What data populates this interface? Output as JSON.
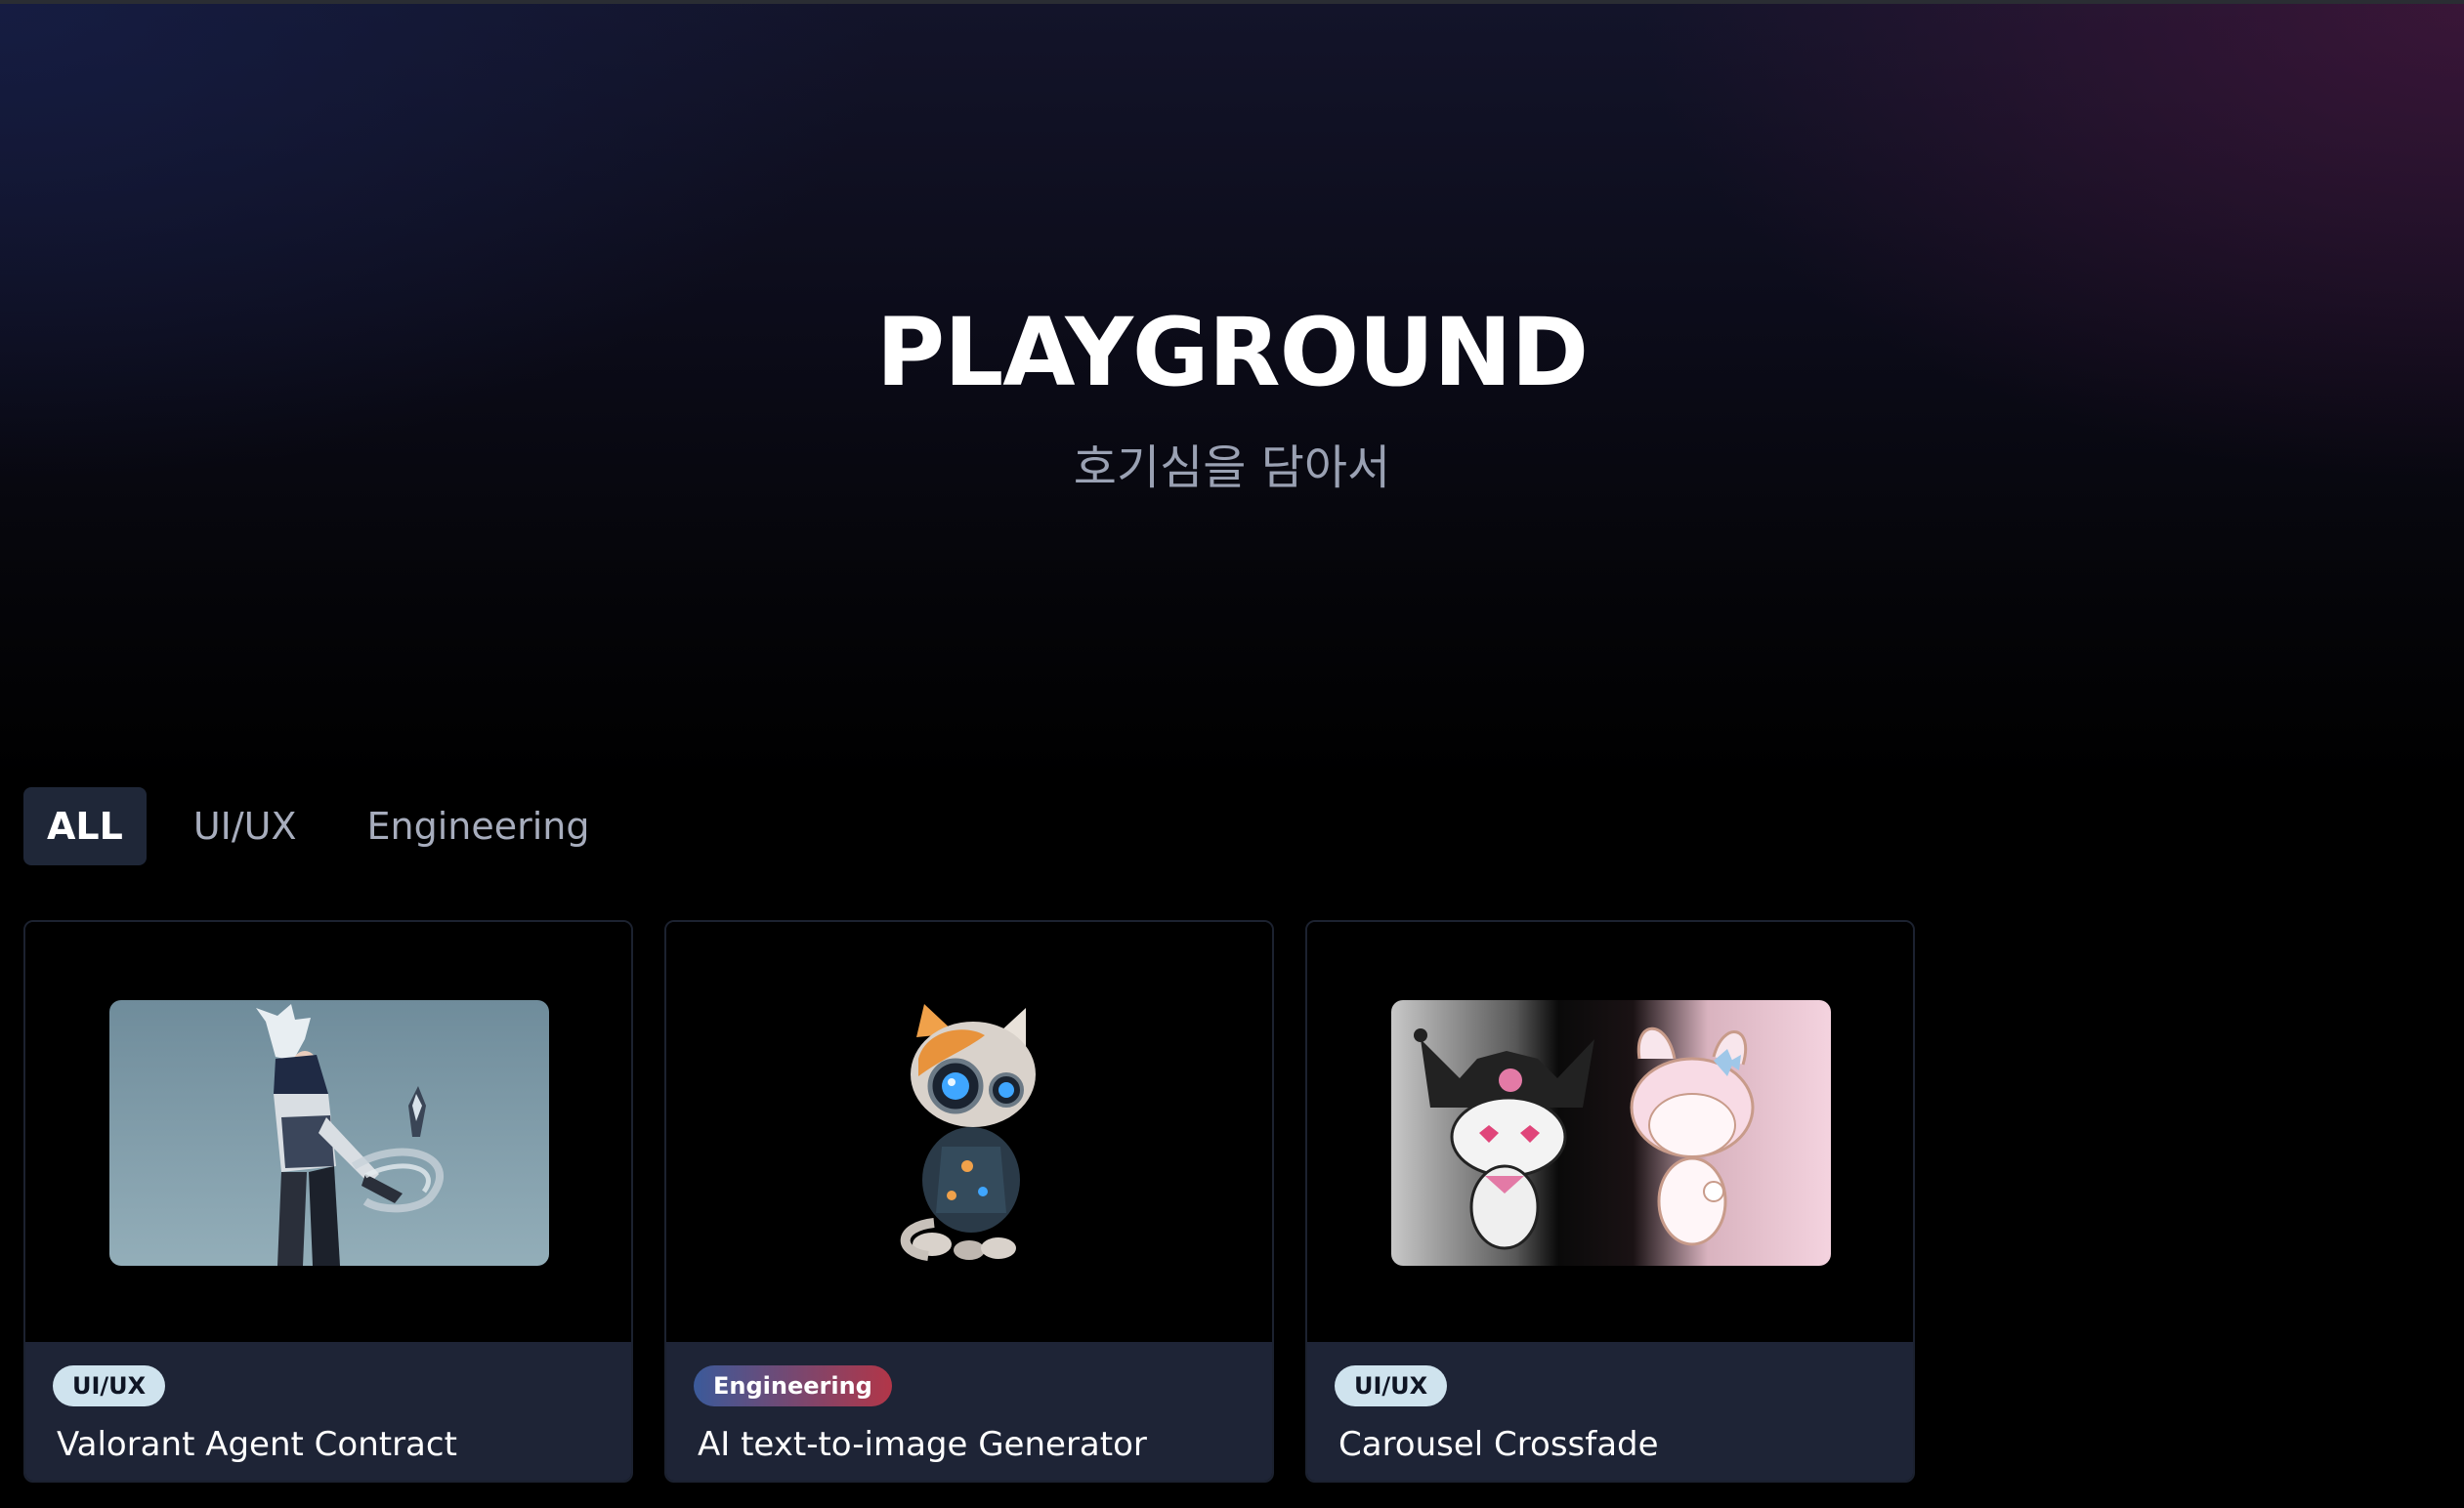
{
  "hero": {
    "title": "PLAYGROUND",
    "subtitle": "호기심을 담아서"
  },
  "tabs": [
    {
      "label": "ALL",
      "active": true
    },
    {
      "label": "UI/UX",
      "active": false
    },
    {
      "label": "Engineering",
      "active": false
    }
  ],
  "cards": [
    {
      "category": "UI/UX",
      "title": "Valorant Agent Contract",
      "image": "valorant-agent-illustration"
    },
    {
      "category": "Engineering",
      "title": "AI text-to-image Generator",
      "image": "robot-cat-illustration"
    },
    {
      "category": "UI/UX",
      "title": "Carousel Crossfade",
      "image": "kuromi-my-melody-crossfade"
    }
  ],
  "colors": {
    "background": "#000000",
    "tab_active_bg": "#1f2738",
    "card_footer_bg": "#1e2436",
    "badge_uiux_bg": "#cfe3ee",
    "badge_engineering_from": "#3b5a9a",
    "badge_engineering_to": "#b23648"
  }
}
